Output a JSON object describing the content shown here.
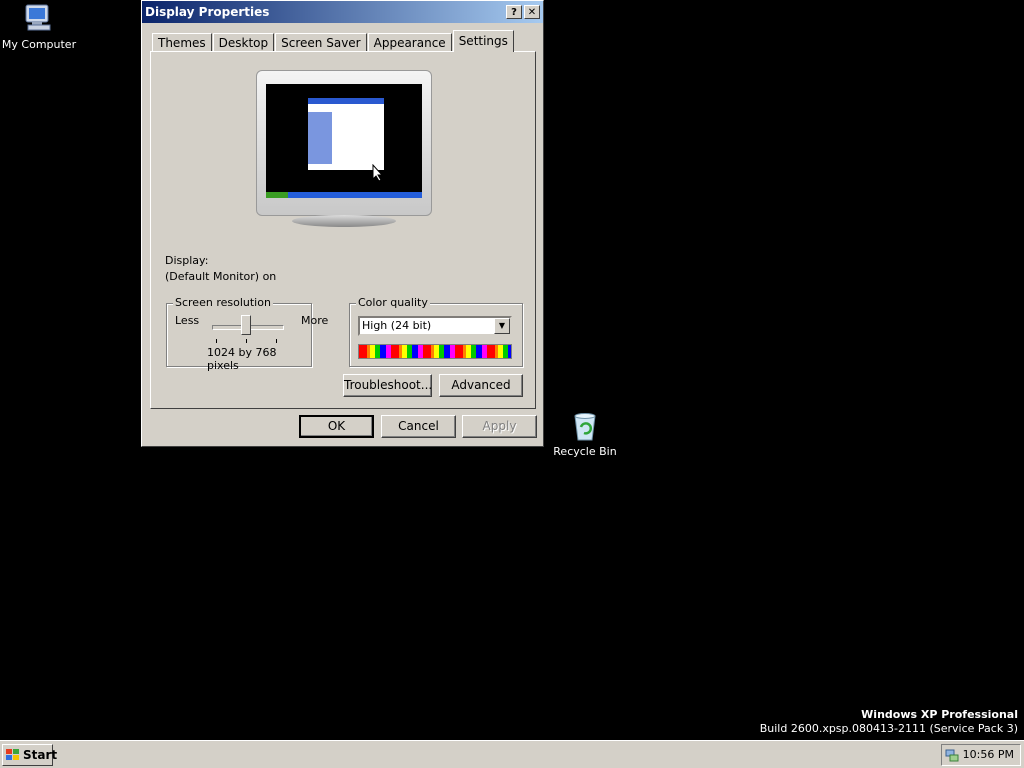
{
  "desktop": {
    "icons": [
      {
        "label": "My Computer"
      },
      {
        "label": "Recycle Bin"
      }
    ]
  },
  "dialog": {
    "title": "Display Properties",
    "help_btn": "?",
    "close_btn": "✕",
    "tabs": [
      "Themes",
      "Desktop",
      "Screen Saver",
      "Appearance",
      "Settings"
    ],
    "active_tab": "Settings",
    "display_label": "Display:",
    "display_value": "(Default Monitor) on",
    "resolution": {
      "group_title": "Screen resolution",
      "less": "Less",
      "more": "More",
      "value_text": "1024 by 768 pixels"
    },
    "color_quality": {
      "group_title": "Color quality",
      "selected": "High (24 bit)"
    },
    "buttons": {
      "troubleshoot": "Troubleshoot...",
      "advanced": "Advanced",
      "ok": "OK",
      "cancel": "Cancel",
      "apply": "Apply"
    }
  },
  "taskbar": {
    "start_label": "Start",
    "clock": "10:56 PM"
  },
  "watermark": {
    "line1": "Windows XP Professional",
    "line2": "Build 2600.xpsp.080413-2111 (Service Pack 3)"
  }
}
